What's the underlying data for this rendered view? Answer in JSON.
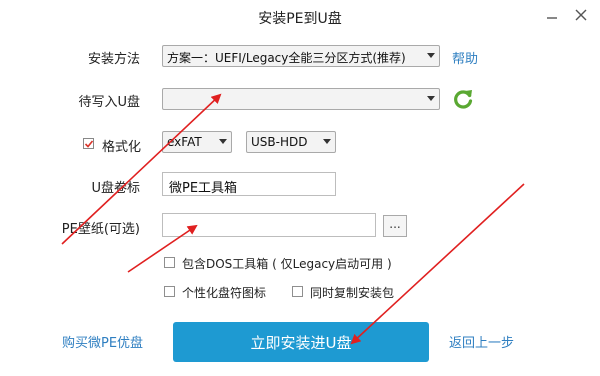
{
  "window": {
    "title": "安装PE到U盘"
  },
  "form": {
    "install_method_label": "安装方法",
    "install_method_value": "方案一：UEFI/Legacy全能三分区方式(推荐)",
    "help_link": "帮助",
    "target_disk_label": "待写入U盘",
    "target_disk_value": "",
    "format_label": "格式化",
    "format_checked": true,
    "filesystem_value": "exFAT",
    "mode_value": "USB-HDD",
    "volume_label": "U盘卷标",
    "volume_value": "微PE工具箱",
    "wallpaper_label": "PE壁纸(可选)",
    "wallpaper_value": "",
    "browse_label": "...",
    "options": [
      {
        "label": "包含DOS工具箱 ( 仅Legacy启动可用 )",
        "checked": false
      },
      {
        "label": "个性化盘符图标",
        "checked": false
      },
      {
        "label": "同时复制安装包",
        "checked": false
      }
    ]
  },
  "footer": {
    "buy_link": "购买微PE优盘",
    "install_button": "立即安装进U盘",
    "back_link": "返回上一步"
  },
  "colors": {
    "accent": "#1e9ad2",
    "link": "#2f7fc1",
    "annotation": "#e02020",
    "refresh": "#5aa832"
  }
}
